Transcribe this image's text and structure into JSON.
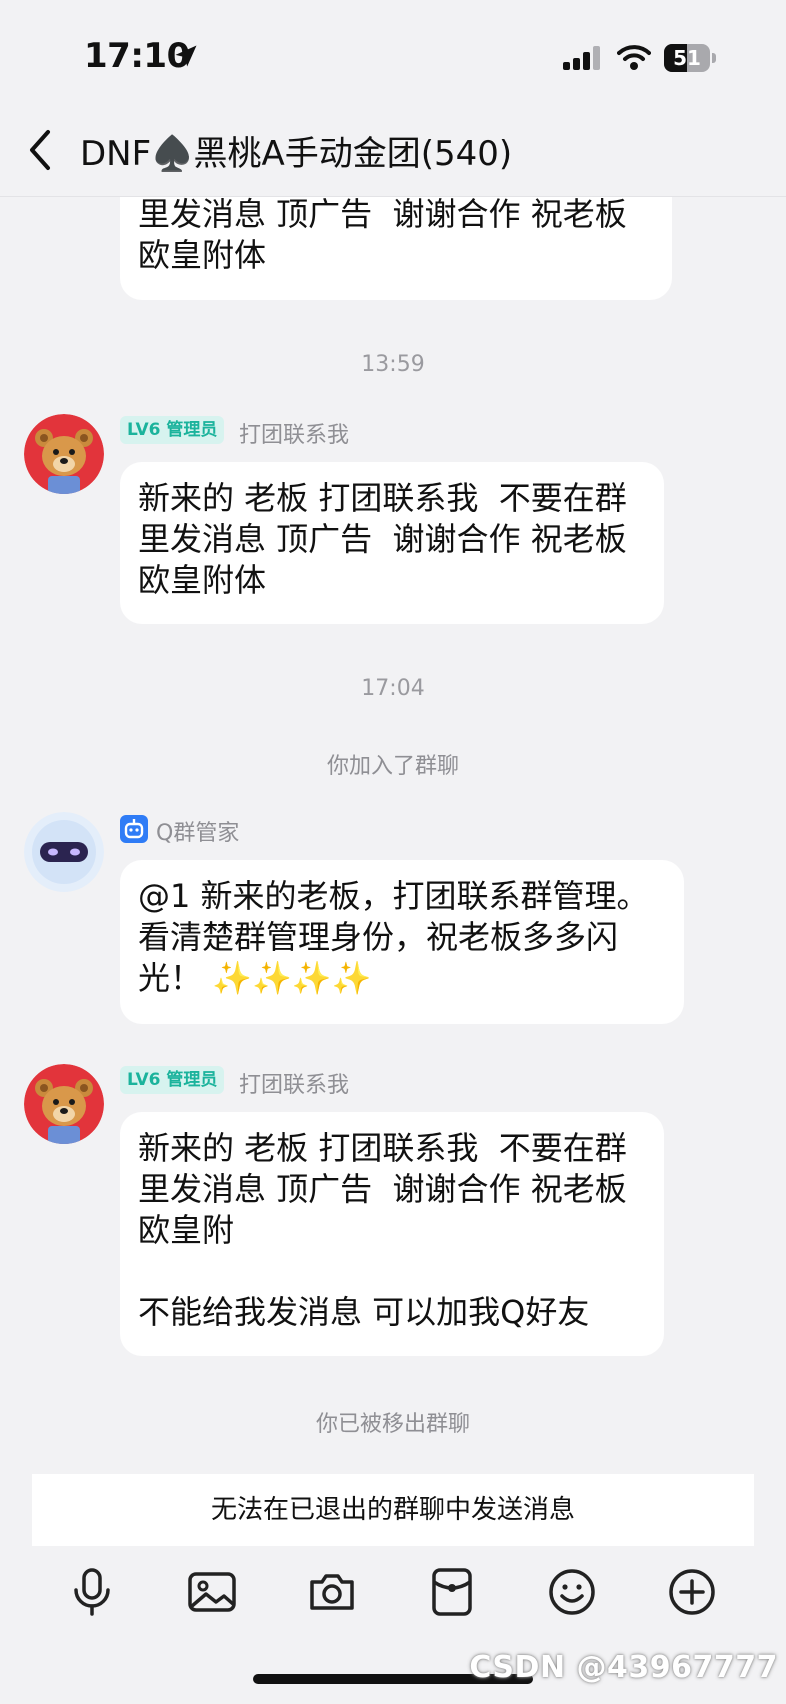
{
  "status_bar": {
    "time": "17:10",
    "battery": "51",
    "battery_level": 0.51
  },
  "header": {
    "title": "DNF♠️黑桃A手动金团(540)"
  },
  "messages": {
    "m0": {
      "text": "里发消息 顶广告  谢谢合作 祝老板\n欧皇附体"
    },
    "t1": "13:59",
    "m1": {
      "badge": "LV6 管理员",
      "sender": "打团联系我",
      "text": "新来的 老板 打团联系我  不要在群\n里发消息 顶广告  谢谢合作 祝老板\n欧皇附体"
    },
    "t2": "17:04",
    "s1": "你加入了群聊",
    "m2": {
      "sender": "Q群管家",
      "text": "@1 新来的老板，打团联系群管理。\n看清楚群管理身份，祝老板多多闪\n光！ ✨✨✨✨"
    },
    "m3": {
      "badge": "LV6 管理员",
      "sender": "打团联系我",
      "text": "新来的 老板 打团联系我  不要在群\n里发消息 顶广告  谢谢合作 祝老板\n欧皇附\n\n不能给我发消息 可以加我Q好友"
    },
    "s2": "你已被移出群聊"
  },
  "footer": {
    "notice": "无法在已退出的群聊中发送消息",
    "toolbar_icons": [
      "microphone-icon",
      "image-icon",
      "camera-icon",
      "red-packet-icon",
      "emoji-icon",
      "plus-icon"
    ]
  },
  "watermark": "CSDN @43967777",
  "colors": {
    "admin_badge_bg": "#d7f3ef",
    "admin_badge_fg": "#1bb39c",
    "bot_icon": "#2f7cf6"
  }
}
